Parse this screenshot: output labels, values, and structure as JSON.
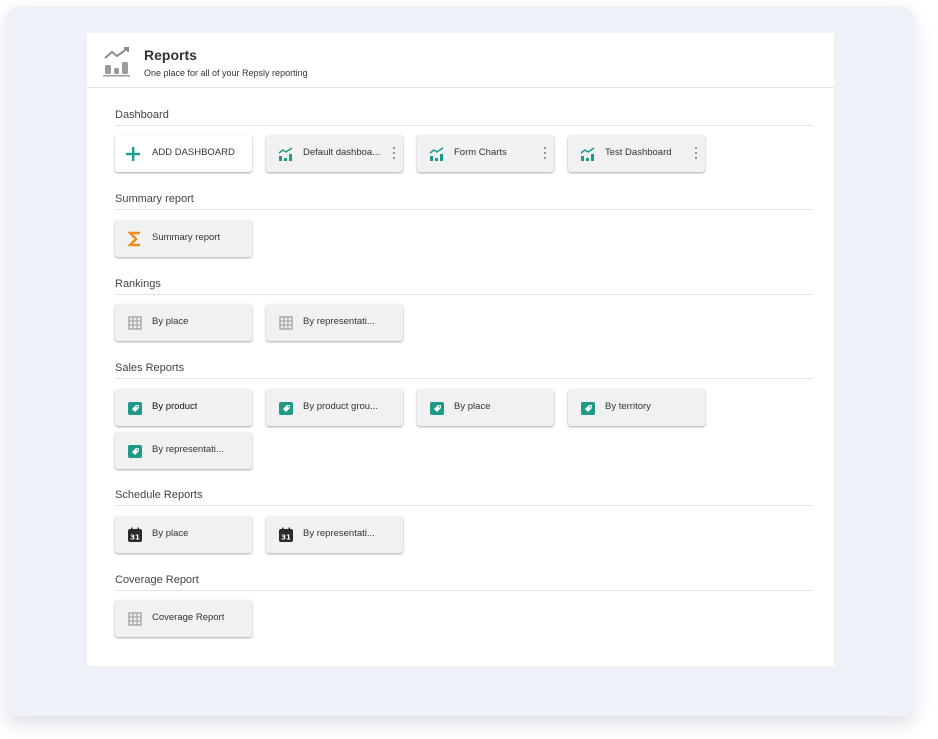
{
  "header": {
    "title": "Reports",
    "subtitle": "One place for all of your Repsly reporting",
    "icon": "reports-chart-icon"
  },
  "colors": {
    "accent": "#1a9e92",
    "sales_icon": "#1f9a88",
    "sigma": "#f08a1c",
    "calendar": "#2b2b2b",
    "grid_icon": "#9a9a9a"
  },
  "sections": {
    "dashboard": {
      "title": "Dashboard",
      "add_label": "ADD DASHBOARD",
      "items": [
        {
          "label": "Default dashboa...",
          "icon": "dashboard-chart-icon"
        },
        {
          "label": "Form Charts",
          "icon": "dashboard-chart-icon"
        },
        {
          "label": "Test Dashboard",
          "icon": "dashboard-chart-icon"
        }
      ]
    },
    "summary": {
      "title": "Summary report",
      "items": [
        {
          "label": "Summary report",
          "icon": "sigma-icon"
        }
      ]
    },
    "rankings": {
      "title": "Rankings",
      "items": [
        {
          "label": "By place",
          "icon": "grid-table-icon"
        },
        {
          "label": "By representati...",
          "icon": "grid-table-icon"
        }
      ]
    },
    "sales": {
      "title": "Sales Reports",
      "items": [
        {
          "label": "By product",
          "icon": "sales-tag-icon"
        },
        {
          "label": "By product grou...",
          "icon": "sales-tag-icon"
        },
        {
          "label": "By place",
          "icon": "sales-tag-icon"
        },
        {
          "label": "By territory",
          "icon": "sales-tag-icon"
        },
        {
          "label": "By representati...",
          "icon": "sales-tag-icon"
        }
      ]
    },
    "schedule": {
      "title": "Schedule Reports",
      "items": [
        {
          "label": "By place",
          "icon": "calendar-icon"
        },
        {
          "label": "By representati...",
          "icon": "calendar-icon"
        }
      ]
    },
    "coverage": {
      "title": "Coverage Report",
      "items": [
        {
          "label": "Coverage Report",
          "icon": "grid-table-icon"
        }
      ]
    }
  },
  "calendar_day": "31"
}
